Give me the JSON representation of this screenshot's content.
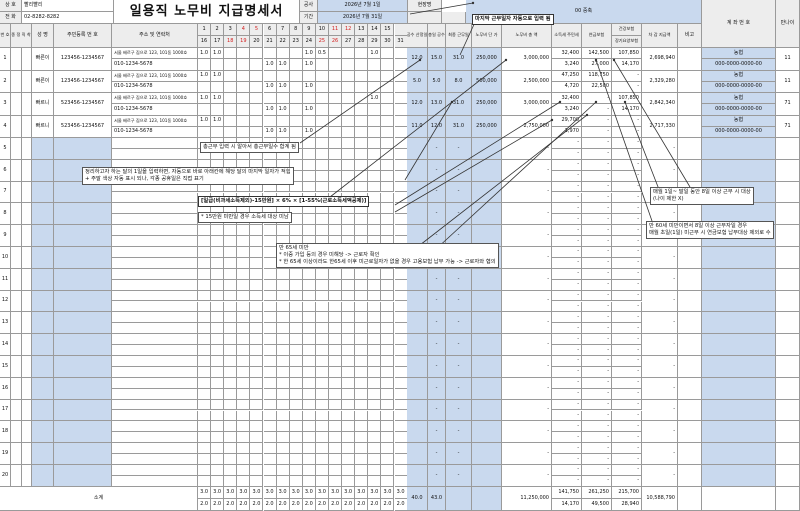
{
  "company": {
    "name_label": "상 호",
    "name_value": "빨리빨리",
    "phone_label": "전 화",
    "phone_value": "02-8282-8282"
  },
  "doc_title": "일용직 노무비 지급명세서",
  "construction": {
    "name_label": "공사",
    "period_label": "기간",
    "start": "2026년 7월 1일",
    "end": "2026년 7월 31일",
    "site_label": "현장명",
    "site_value": "00 중축"
  },
  "headers": {
    "no": "번\n호",
    "job": "직 종\n정 직 착 직",
    "name": "성 명",
    "rrn": "주민등록\n번 호",
    "address": "주소 및 연락처",
    "work_days": "출역\n일수",
    "daily_wage": "1일\n임금",
    "unit_price": "노무비\n단 가",
    "labor_total": "노무비\n총 액",
    "income_tax": "소득세\n주민세",
    "pension": "연금보험",
    "health": "건강보험",
    "ltc": "장기요양보험",
    "net_pay": "차 감\n지급액",
    "remark": "비고",
    "account": "계 좌 번 호",
    "age": "만나이",
    "work_count": "공수\n산정일",
    "work_hours": "총일\n공수",
    "total_day": "최종\n근무일"
  },
  "days_row1": [
    "1",
    "2",
    "3",
    "4",
    "5",
    "6",
    "7",
    "8",
    "9",
    "10",
    "11",
    "12",
    "13",
    "14",
    "15"
  ],
  "days_row2": [
    "16",
    "17",
    "18",
    "19",
    "20",
    "21",
    "22",
    "23",
    "24",
    "25",
    "26",
    "27",
    "28",
    "29",
    "30",
    "31"
  ],
  "workers": [
    {
      "no": "1",
      "name": "빠른이",
      "rrn": "123456-1234567",
      "addr": "서울 배르구 집으로 123, 101동 1000호",
      "phone": "010-1234-5678",
      "c1": "12.0",
      "c2": "15.0",
      "c3": "31.0",
      "unit": "250,000",
      "total": "3,000,000",
      "tax1": "32,400",
      "tax2": "3,240",
      "pen1": "142,500",
      "pen2": "27,000",
      "hea1": "107,850",
      "hea2": "14,170",
      "net": "2,698,940",
      "bank": "농협",
      "acct": "000-0000-0000-00",
      "age": "11"
    },
    {
      "no": "2",
      "name": "빠른이",
      "rrn": "123456-1234567",
      "addr": "서울 배르구 집으로 123, 101동 1000호",
      "phone": "010-1234-5678",
      "c1": "5.0",
      "c2": "5.0",
      "c3": "8.0",
      "unit": "500,000",
      "total": "2,500,000",
      "tax1": "47,250",
      "tax2": "4,720",
      "pen1": "118,750",
      "pen2": "22,500",
      "hea1": "-",
      "hea2": "-",
      "net": "2,329,280",
      "bank": "농협",
      "acct": "000-0000-0000-00",
      "age": "11"
    },
    {
      "no": "3",
      "name": "빠르니",
      "rrn": "523456-1234567",
      "addr": "서울 배르구 집으로 123, 101동 1000호",
      "phone": "010-1234-5678",
      "c1": "12.0",
      "c2": "13.0",
      "c3": "31.0",
      "unit": "250,000",
      "total": "3,000,000",
      "tax1": "32,400",
      "tax2": "3,240",
      "pen1": "-",
      "pen2": "-",
      "hea1": "107,850",
      "hea2": "14,170",
      "net": "2,842,340",
      "bank": "농협",
      "acct": "000-0000-0000-00",
      "age": "71"
    },
    {
      "no": "4",
      "name": "빠르니",
      "rrn": "523456-1234567",
      "addr": "서울 배르구 집으로 123, 101동 1000호",
      "phone": "010-1234-5678",
      "c1": "11.0",
      "c2": "12.0",
      "c3": "31.0",
      "unit": "250,000",
      "total": "2,750,000",
      "tax1": "29,700",
      "tax2": "2,970",
      "pen1": "-",
      "pen2": "-",
      "hea1": "-",
      "hea2": "-",
      "net": "2,717,330",
      "bank": "농협",
      "acct": "000-0000-0000-00",
      "age": "71"
    }
  ],
  "empty_rows": [
    "5",
    "6",
    "7",
    "8",
    "9",
    "10",
    "11",
    "12",
    "13",
    "14",
    "15",
    "16",
    "17",
    "18",
    "19",
    "20"
  ],
  "dash": "-",
  "day_values": [
    "1.0",
    "0.5"
  ],
  "totals": {
    "label": "소계",
    "days": "3.0",
    "half": "2.0",
    "c1": "40.0",
    "c2": "43.0",
    "labor": "11,250,000",
    "tax1": "141,750",
    "tax2": "14,170",
    "pen1": "261,250",
    "pen2": "49,500",
    "hea1": "215,700",
    "hea2": "28,940",
    "net": "10,588,790"
  },
  "notes": {
    "last_day": "마지막 근무일자 자동으로 입력 됨",
    "total_days": "총근무 입력 시 알아서 총근무일수 합계 됨",
    "organize": "정리하고자 하는 달의 1일을 입력하면, 자동으로 바로 아래칸에 해당 달의 마지막 일자가 적힘\n+ 주말 색상 자동 표시 되나, 각종 공휴일은 직접 표기",
    "tax_formula": "[일급(비과세소득제외)-15만원] × 6% × [1-55%(근로소득세액공제)]",
    "tax_under": "* 15만원 미만일 경우 소득세 대상 미남",
    "under65": "만 65세 미만\n* 이중 가입 등의 경우 미해당 -> 근로자 확인\n* 한 65세 이상이라도 한65세 이후 미근로일자가 없을 경우 고용보험 납부 가능 -> 근로자와 협의",
    "health_note": "매월 1일~ 말일 동안 8일 이상 근무 시 대상\n(나이 제한 X)",
    "pension_note": "만 60세 미만이면서 8일 이상 근무자일 경우\n매월 초일(1일) 미근무 시 연금보험 납부대상 제외로 수"
  }
}
